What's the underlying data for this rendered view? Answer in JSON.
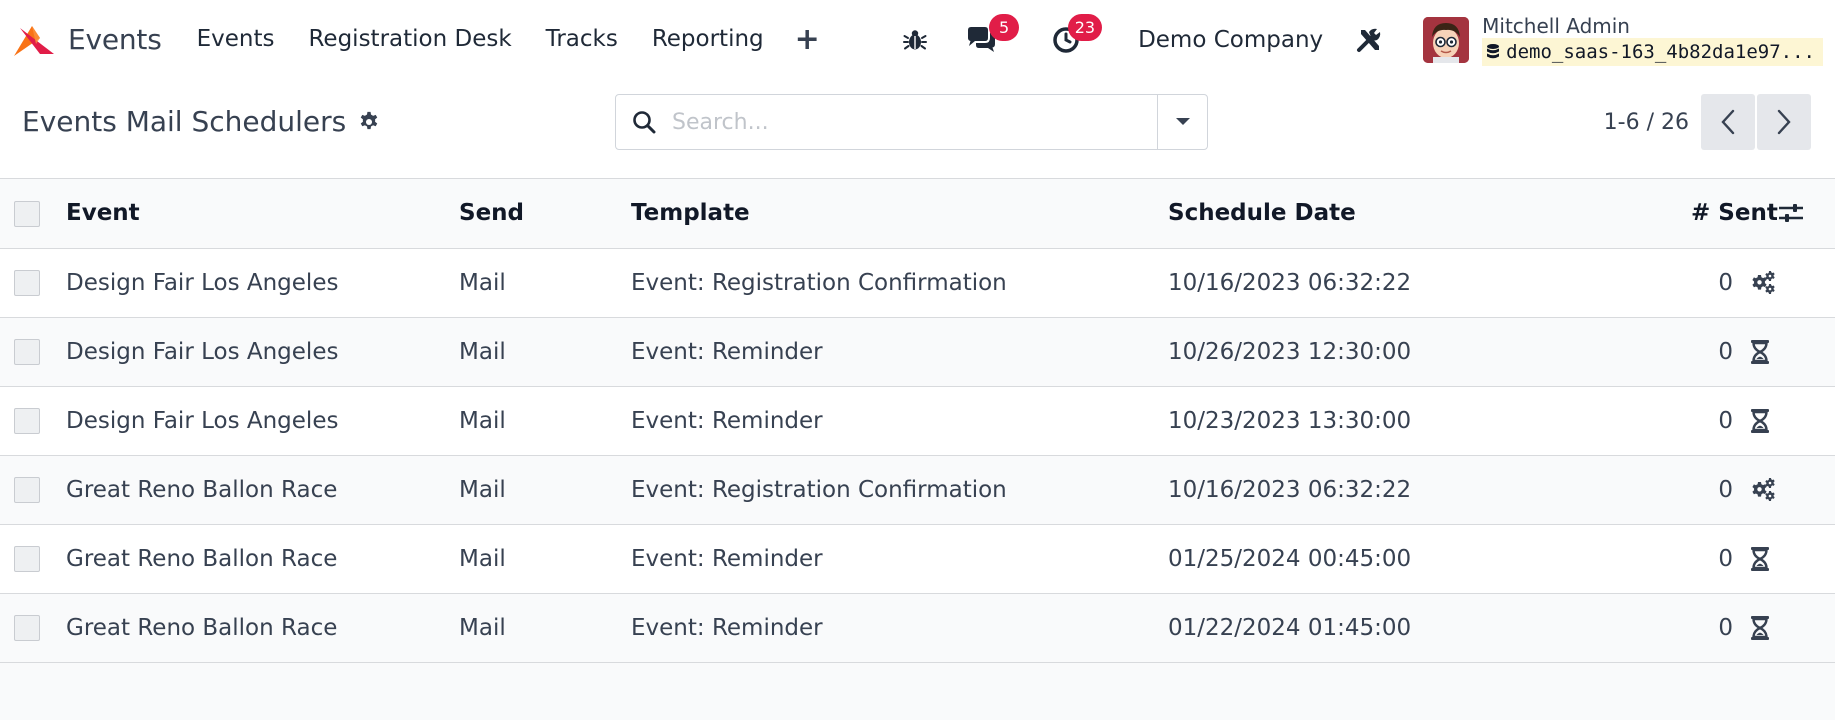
{
  "navbar": {
    "app_name": "Events",
    "menu": [
      "Events",
      "Registration Desk",
      "Tracks",
      "Reporting"
    ],
    "plus_label": "+",
    "messages_count": "5",
    "activities_count": "23",
    "company": "Demo Company",
    "user_name": "Mitchell Admin",
    "database": "demo_saas-163_4b82da1e97..."
  },
  "control_panel": {
    "title": "Events Mail Schedulers",
    "search_placeholder": "Search...",
    "pager": "1-6 / 26"
  },
  "table": {
    "columns": [
      "Event",
      "Send",
      "Template",
      "Schedule Date",
      "# Sent"
    ],
    "rows": [
      {
        "event": "Design Fair Los Angeles",
        "send": "Mail",
        "template": "Event: Registration Confirmation",
        "date": "10/16/2023 06:32:22",
        "sent": "0",
        "state_icon": "gears-icon"
      },
      {
        "event": "Design Fair Los Angeles",
        "send": "Mail",
        "template": "Event: Reminder",
        "date": "10/26/2023 12:30:00",
        "sent": "0",
        "state_icon": "hourglass-icon"
      },
      {
        "event": "Design Fair Los Angeles",
        "send": "Mail",
        "template": "Event: Reminder",
        "date": "10/23/2023 13:30:00",
        "sent": "0",
        "state_icon": "hourglass-icon"
      },
      {
        "event": "Great Reno Ballon Race",
        "send": "Mail",
        "template": "Event: Registration Confirmation",
        "date": "10/16/2023 06:32:22",
        "sent": "0",
        "state_icon": "gears-icon"
      },
      {
        "event": "Great Reno Ballon Race",
        "send": "Mail",
        "template": "Event: Reminder",
        "date": "01/25/2024 00:45:00",
        "sent": "0",
        "state_icon": "hourglass-icon"
      },
      {
        "event": "Great Reno Ballon Race",
        "send": "Mail",
        "template": "Event: Reminder",
        "date": "01/22/2024 01:45:00",
        "sent": "0",
        "state_icon": "hourglass-icon"
      }
    ]
  },
  "colors": {
    "badge": "#e11d48",
    "db_chip_bg": "#fdf6d4",
    "logo_orange": "#f97316",
    "logo_red": "#e11d48"
  }
}
